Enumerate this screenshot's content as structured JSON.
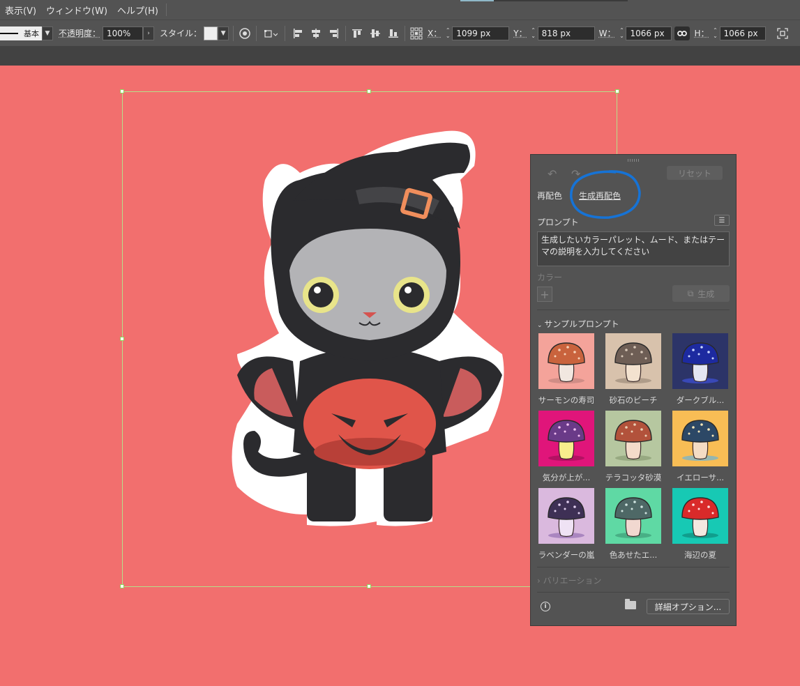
{
  "menu": [
    "表示(V)",
    "ウィンドウ(W)",
    "ヘルプ(H)"
  ],
  "toolbar": {
    "stroke_label": "基本",
    "opacity_label": "不透明度：",
    "opacity_value": "100%",
    "style_label": "スタイル：",
    "x_label": "X：",
    "x_value": "1099 px",
    "y_label": "Y：",
    "y_value": "818 px",
    "w_label": "W：",
    "w_value": "1066 px",
    "h_label": "H：",
    "h_value": "1066 px"
  },
  "panel": {
    "reset_label": "リセット",
    "tab_recolor": "再配色",
    "tab_generative": "生成再配色",
    "prompt_label": "プロンプト",
    "prompt_placeholder": "生成したいカラーパレット、ムード、またはテーマの説明を入力してください",
    "color_label": "カラー",
    "generate_label": "生成",
    "samples_label": "サンプルプロンプト",
    "variations_label": "バリエーション",
    "detail_options_label": "詳細オプション...",
    "samples": [
      {
        "label": "サーモンの寿司",
        "bg": "#f4a39a",
        "cap": "#c9633d",
        "dots": "#f6d2b8",
        "stem": "#f1e7e0",
        "shade": "#c2837d"
      },
      {
        "label": "砂石のビーチ",
        "bg": "#d8c2ac",
        "cap": "#6e5e55",
        "dots": "#d8c8b8",
        "stem": "#f3e2cf",
        "shade": "#9e8b7a"
      },
      {
        "label": "ダークブル...",
        "bg": "#2c3468",
        "cap": "#1d2aa0",
        "dots": "#c9d6ff",
        "stem": "#e4e6f2",
        "shade": "#3f51d8"
      },
      {
        "label": "気分が上が...",
        "bg": "#e0157a",
        "cap": "#6a3a88",
        "dots": "#f2c0f2",
        "stem": "#f8ee8c",
        "shade": "#a01058"
      },
      {
        "label": "テラコッタ砂漠",
        "bg": "#b6c7a0",
        "cap": "#b2523b",
        "dots": "#ead0b6",
        "stem": "#f4dcca",
        "shade": "#8a9c74"
      },
      {
        "label": "イエローサ...",
        "bg": "#f8bd55",
        "cap": "#2c4866",
        "dots": "#f8e7b8",
        "stem": "#f4dcc4",
        "shade": "#6eb4d6"
      },
      {
        "label": "ラベンダーの嵐",
        "bg": "#dab9de",
        "cap": "#3e3055",
        "dots": "#e2d0f0",
        "stem": "#efe2f4",
        "shade": "#9670b4"
      },
      {
        "label": "色あせたエ...",
        "bg": "#5fd9a4",
        "cap": "#4e6866",
        "dots": "#d0e4e0",
        "stem": "#f1d8d0",
        "shade": "#3f9c78"
      },
      {
        "label": "海辺の夏",
        "bg": "#17c9b4",
        "cap": "#d92a2a",
        "dots": "#ffe2e2",
        "stem": "#f3e8e0",
        "shade": "#0e8b7c"
      }
    ]
  }
}
